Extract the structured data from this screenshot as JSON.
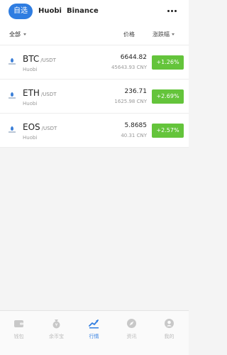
{
  "header": {
    "tabs": [
      {
        "label": "自选",
        "active": true
      },
      {
        "label": "Huobi",
        "active": false
      },
      {
        "label": "Binance",
        "active": false
      }
    ],
    "more_icon": "more-horizontal-icon"
  },
  "filter": {
    "all_label": "全部",
    "price_label": "价格",
    "change_label": "涨跌幅"
  },
  "markets": [
    {
      "symbol": "BTC",
      "quote": "/USDT",
      "exchange": "Huobi",
      "price": "6644.82",
      "cny": "45643.93 CNY",
      "change": "+1.26%"
    },
    {
      "symbol": "ETH",
      "quote": "/USDT",
      "exchange": "Huobi",
      "price": "236.71",
      "cny": "1625.98 CNY",
      "change": "+2.69%"
    },
    {
      "symbol": "EOS",
      "quote": "/USDT",
      "exchange": "Huobi",
      "price": "5.8685",
      "cny": "40.31 CNY",
      "change": "+2.57%"
    }
  ],
  "nav": [
    {
      "label": "钱包",
      "icon": "wallet-icon",
      "active": false
    },
    {
      "label": "余币宝",
      "icon": "coin-bag-icon",
      "active": false
    },
    {
      "label": "行情",
      "icon": "market-chart-icon",
      "active": true
    },
    {
      "label": "资讯",
      "icon": "compass-icon",
      "active": false
    },
    {
      "label": "我的",
      "icon": "profile-icon",
      "active": false
    }
  ],
  "colors": {
    "accent": "#2f7de1",
    "up": "#64c43b",
    "inactive": "#bbbbbb"
  }
}
